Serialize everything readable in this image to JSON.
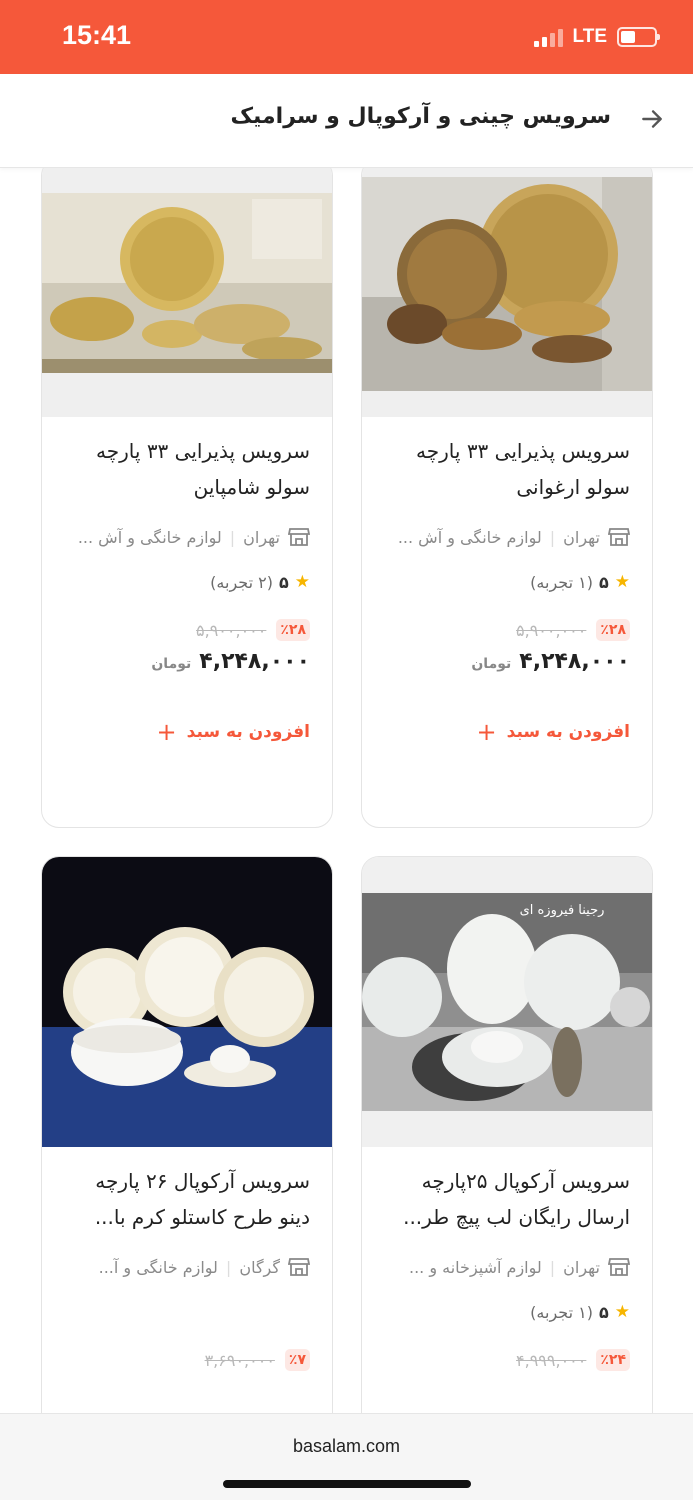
{
  "status_bar": {
    "time": "15:41",
    "network": "LTE"
  },
  "header": {
    "title": "سرویس چینی و آرکوپال و سرامیک",
    "back_icon": "arrow-right-icon"
  },
  "colors": {
    "accent": "#f5583a",
    "star": "#f7b500"
  },
  "products": [
    {
      "title_line1": "سرویس پذیرایی ۳۳ پارچه",
      "title_line2": "سولو ارغوانی",
      "city": "تهران",
      "category": "لوازم خانگی و آش ...",
      "rating": "۵",
      "reviews": "(۱ تجربه)",
      "discount": "٪۲۸",
      "old_price": "۵,۹۰۰,۰۰۰",
      "price": "۴,۲۴۸,۰۰۰",
      "currency": "تومان",
      "add_label": "افزودن به سبد"
    },
    {
      "title_line1": "سرویس پذیرایی ۳۳ پارچه",
      "title_line2": "سولو شامپاین",
      "city": "تهران",
      "category": "لوازم خانگی و آش ...",
      "rating": "۵",
      "reviews": "(۲ تجربه)",
      "discount": "٪۲۸",
      "old_price": "۵,۹۰۰,۰۰۰",
      "price": "۴,۲۴۸,۰۰۰",
      "currency": "تومان",
      "add_label": "افزودن به سبد"
    },
    {
      "title_line1": "سرویس آرکوپال ۲۵پارچه",
      "title_line2": "ارسال رایگان لب پیچ طر...",
      "city": "تهران",
      "category": "لوازم آشپزخانه و ...",
      "rating": "۵",
      "reviews": "(۱ تجربه)",
      "discount": "٪۲۴",
      "old_price": "۴,۹۹۹,۰۰۰",
      "image_caption": "رجینا فیروزه ای"
    },
    {
      "title_line1": "سرویس آرکوپال ۲۶ پارچه",
      "title_line2": "دینو طرح کاستلو کرم با...",
      "city": "گرگان",
      "category": "لوازم خانگی و آ...",
      "discount": "٪۷",
      "old_price": "۳,۶۹۰,۰۰۰"
    }
  ],
  "browser": {
    "url": "basalam.com"
  }
}
